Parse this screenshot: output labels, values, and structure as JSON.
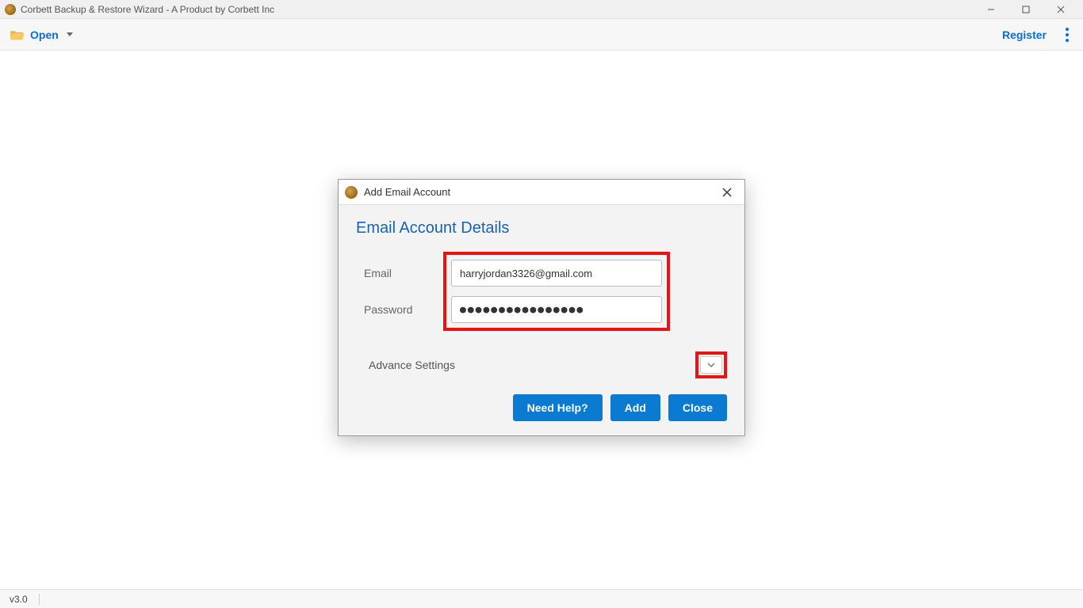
{
  "window": {
    "title": "Corbett Backup & Restore Wizard - A Product by Corbett Inc"
  },
  "toolbar": {
    "open_label": "Open",
    "register_label": "Register"
  },
  "modal": {
    "title": "Add Email Account",
    "heading": "Email Account Details",
    "email_label": "Email",
    "email_value": "harryjordan3326@gmail.com",
    "password_label": "Password",
    "password_value": "●●●●●●●●●●●●●●●●",
    "advance_label": "Advance Settings",
    "buttons": {
      "help": "Need Help?",
      "add": "Add",
      "close": "Close"
    }
  },
  "statusbar": {
    "version": "v3.0"
  }
}
